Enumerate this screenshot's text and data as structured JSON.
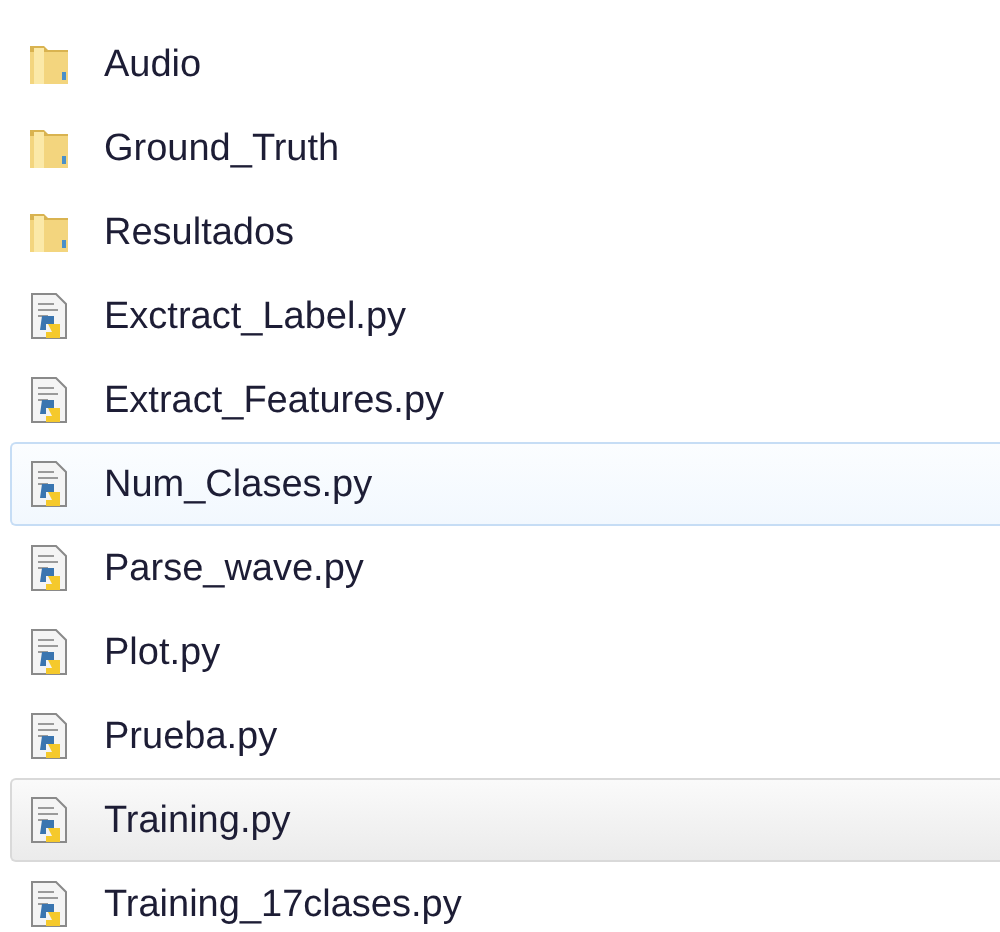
{
  "files": [
    {
      "name": "Audio",
      "kind": "folder",
      "selected": false,
      "hovered": false
    },
    {
      "name": "Ground_Truth",
      "kind": "folder",
      "selected": false,
      "hovered": false
    },
    {
      "name": "Resultados",
      "kind": "folder",
      "selected": false,
      "hovered": false
    },
    {
      "name": "Exctract_Label.py",
      "kind": "python",
      "selected": false,
      "hovered": false
    },
    {
      "name": "Extract_Features.py",
      "kind": "python",
      "selected": false,
      "hovered": false
    },
    {
      "name": "Num_Clases.py",
      "kind": "python",
      "selected": false,
      "hovered": true
    },
    {
      "name": "Parse_wave.py",
      "kind": "python",
      "selected": false,
      "hovered": false
    },
    {
      "name": "Plot.py",
      "kind": "python",
      "selected": false,
      "hovered": false
    },
    {
      "name": "Prueba.py",
      "kind": "python",
      "selected": false,
      "hovered": false
    },
    {
      "name": "Training.py",
      "kind": "python",
      "selected": true,
      "hovered": false
    },
    {
      "name": "Training_17clases.py",
      "kind": "python",
      "selected": false,
      "hovered": false
    }
  ]
}
